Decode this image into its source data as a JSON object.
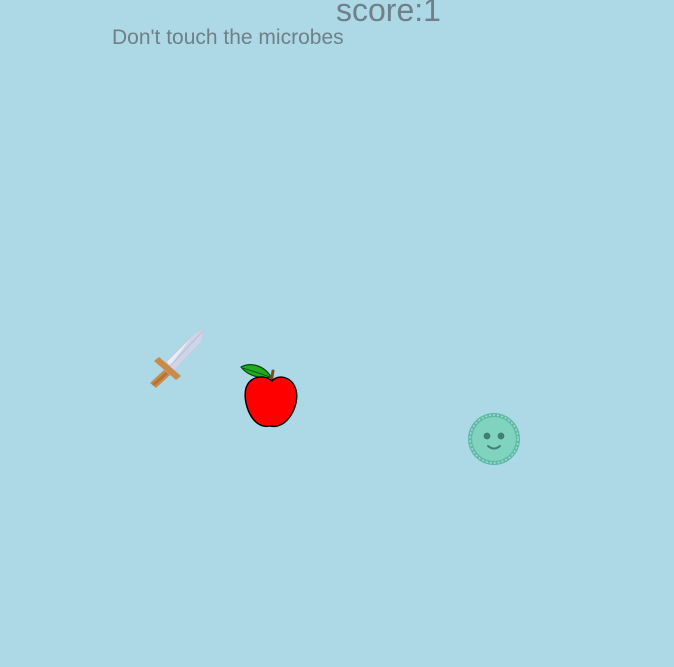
{
  "hud": {
    "score_text": "score:1",
    "hint_text": "Don't touch the microbes"
  },
  "colors": {
    "background": "#add8e6",
    "text": "#6f8088",
    "apple": "#ff0000",
    "leaf": "#22aa22",
    "microbe": "#7fd3bf",
    "microbe_outline": "#5fb8a4",
    "blade": "#e8ecf5",
    "hilt": "#c98a4a"
  },
  "sprites": {
    "player": "sword-icon",
    "pickup": "apple-icon",
    "enemy": "microbe-icon"
  }
}
